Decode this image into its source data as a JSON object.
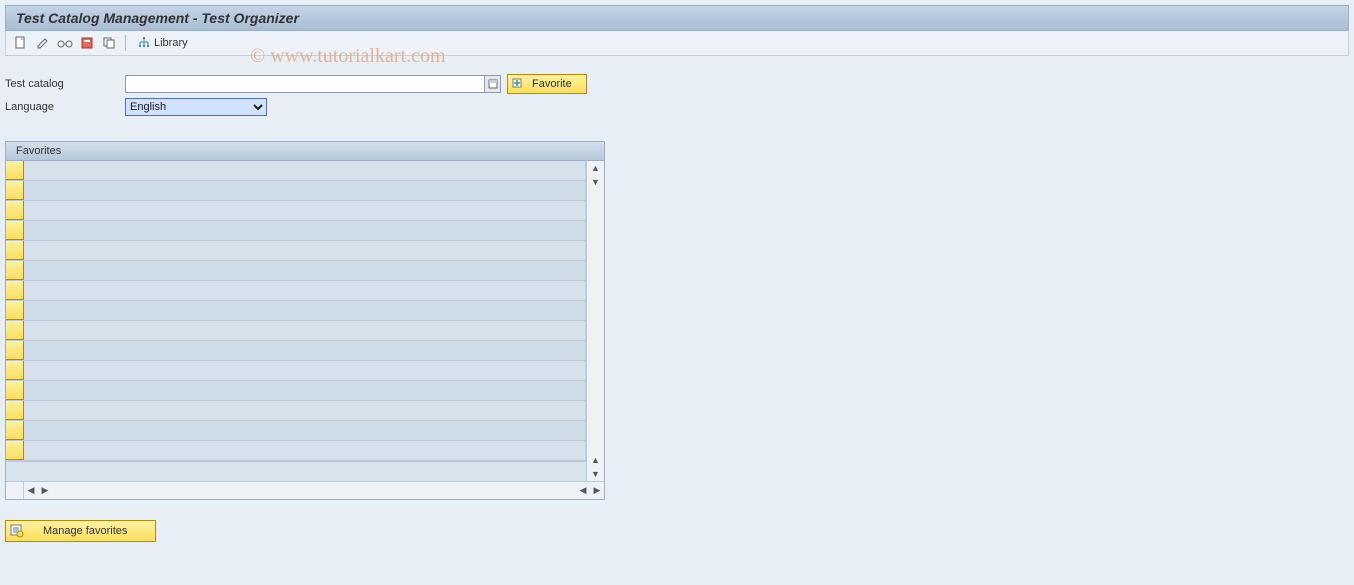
{
  "title": "Test Catalog Management - Test Organizer",
  "toolbar": {
    "library_label": "Library"
  },
  "form": {
    "test_catalog_label": "Test catalog",
    "test_catalog_value": "",
    "language_label": "Language",
    "language_value": "English",
    "language_options": [
      "English"
    ]
  },
  "favorite_button_label": "Favorite",
  "favorites_panel": {
    "header": "Favorites",
    "row_count": 15
  },
  "manage_favorites_label": "Manage favorites",
  "watermark": "© www.tutorialkart.com"
}
